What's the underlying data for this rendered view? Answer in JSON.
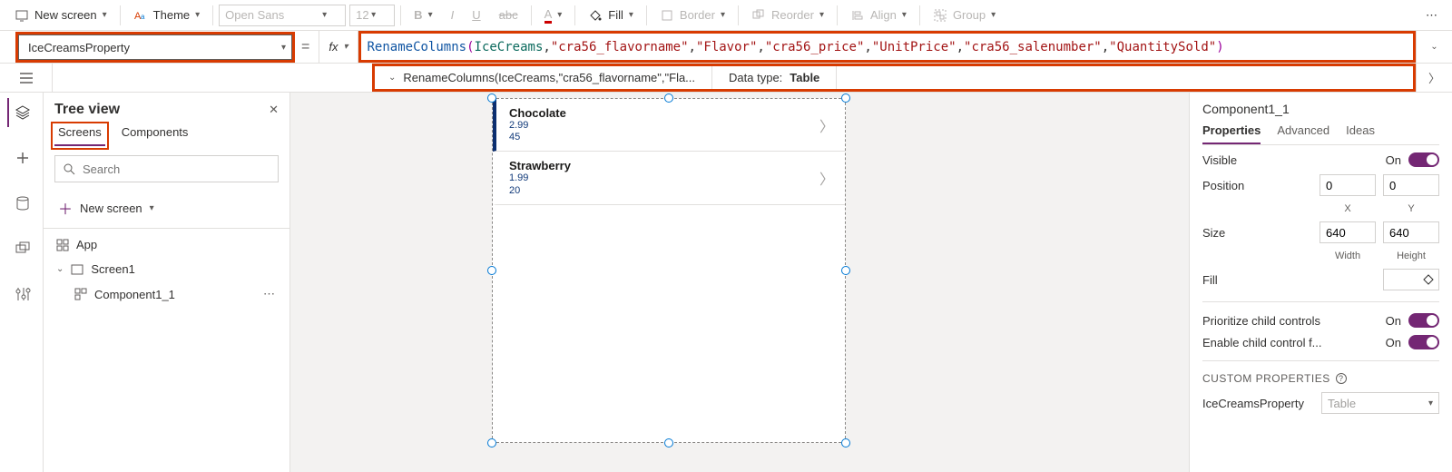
{
  "toolbar": {
    "new_screen": "New screen",
    "theme": "Theme",
    "font": "Open Sans",
    "font_size": "12",
    "fill": "Fill",
    "border": "Border",
    "reorder": "Reorder",
    "align": "Align",
    "group": "Group"
  },
  "formula": {
    "property": "IceCreamsProperty",
    "fx_label": "fx",
    "fn": "RenameColumns",
    "id": "IceCreams",
    "args": [
      "\"cra56_flavorname\"",
      "\"Flavor\"",
      "\"cra56_price\"",
      "\"UnitPrice\"",
      "\"cra56_salenumber\"",
      "\"QuantitySold\""
    ],
    "preview": "RenameColumns(IceCreams,\"cra56_flavorname\",\"Fla...",
    "datatype_label": "Data type:",
    "datatype_value": "Table"
  },
  "tree": {
    "title": "Tree view",
    "tab_screens": "Screens",
    "tab_components": "Components",
    "search_placeholder": "Search",
    "new_screen": "New screen",
    "app": "App",
    "screen1": "Screen1",
    "component": "Component1_1"
  },
  "canvas": {
    "items": [
      {
        "title": "Chocolate",
        "price": "2.99",
        "qty": "45"
      },
      {
        "title": "Strawberry",
        "price": "1.99",
        "qty": "20"
      }
    ]
  },
  "props": {
    "header": "Component1_1",
    "tab_props": "Properties",
    "tab_adv": "Advanced",
    "tab_ideas": "Ideas",
    "visible": "Visible",
    "on": "On",
    "position": "Position",
    "pos_x": "0",
    "pos_y": "0",
    "x_label": "X",
    "y_label": "Y",
    "size": "Size",
    "w": "640",
    "h": "640",
    "w_label": "Width",
    "h_label": "Height",
    "fill": "Fill",
    "prioritize": "Prioritize child controls",
    "enable_child": "Enable child control f...",
    "custom_hdr": "CUSTOM PROPERTIES",
    "custom_prop": "IceCreamsProperty",
    "custom_type": "Table"
  }
}
